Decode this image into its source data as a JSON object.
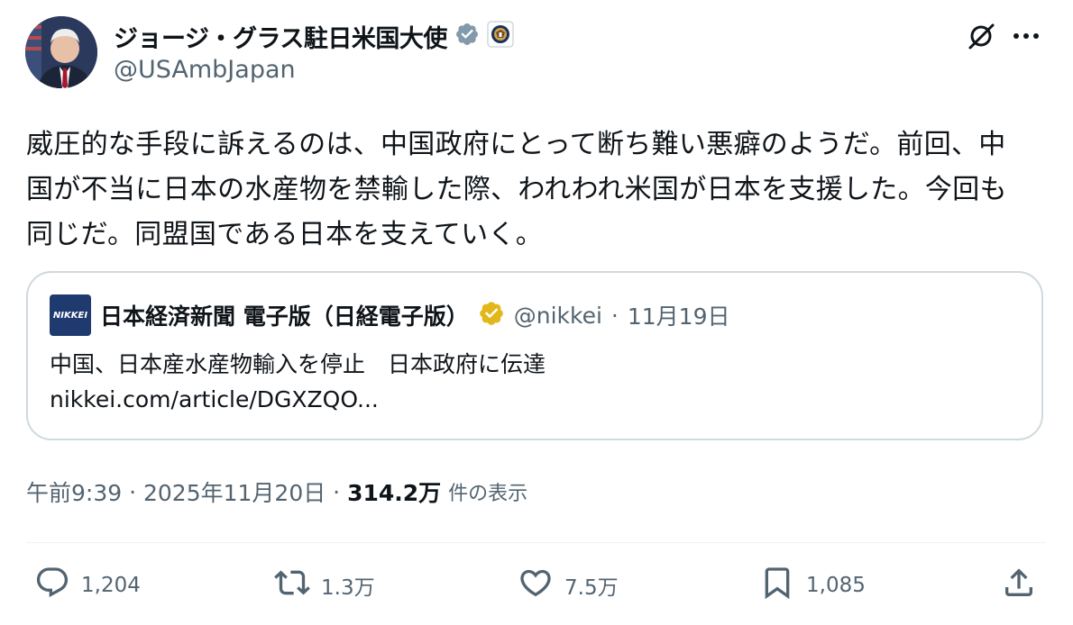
{
  "author": {
    "name": "ジョージ・グラス駐日米国大使",
    "handle": "@USAmbJapan"
  },
  "tweet": {
    "text": "威圧的な手段に訴えるのは、中国政府にとって断ち難い悪癖のようだ。前回、中\n国が不当に日本の水産物を禁輸した際、われわれ米国が日本を支援した。今回も\n同じだ。同盟国である日本を支えていく。"
  },
  "quote": {
    "logo_text": "NIKKEI",
    "name": "日本経済新聞 電子版（日経電子版）",
    "handle": "@nikkei",
    "separator": "·",
    "date": "11月19日",
    "title": "中国、日本産水産物輸入を停止　日本政府に伝達",
    "link": "nikkei.com/article/DGXZQO..."
  },
  "meta": {
    "time": "午前9:39",
    "sep1": " · ",
    "date": "2025年11月20日",
    "sep2": " · ",
    "views": "314.2万",
    "views_label": "件の表示"
  },
  "actions": {
    "replies": "1,204",
    "reposts": "1.3万",
    "likes": "7.5万",
    "bookmarks": "1,085"
  },
  "colors": {
    "verified_gray": "#829aab",
    "verified_gold": "#e2b719",
    "secondary_text": "#536471",
    "border": "#cfd9de"
  }
}
